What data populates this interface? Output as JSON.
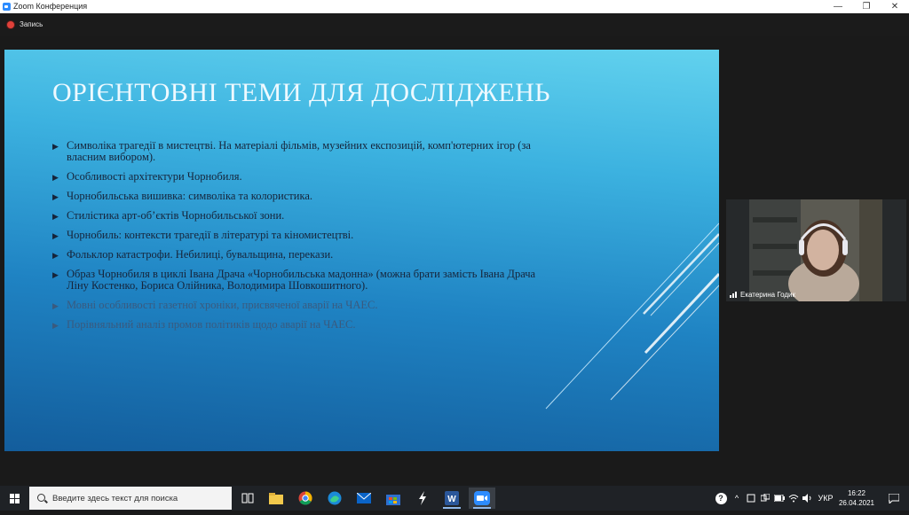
{
  "window": {
    "title": "Zoom Конференция",
    "controls": {
      "minimize": "—",
      "maximize": "❐",
      "close": "✕"
    }
  },
  "recording": {
    "label": "Запись",
    "color": "#e0413a"
  },
  "slide": {
    "title": "ОРІЄНТОВНІ ТЕМИ ДЛЯ ДОСЛІДЖЕНЬ",
    "bullet_glyph": "▶",
    "items": [
      {
        "text": "Символіка трагедії в мистецтві. На матеріалі фільмів, музейних експозицій, комп'ютерних ігор (за власним вибором).",
        "highlight": true
      },
      {
        "text": "Особливості архітектури Чорнобиля.",
        "highlight": true
      },
      {
        "text": "Чорнобильська вишивка: символіка та колористика.",
        "highlight": true
      },
      {
        "text": "Стилістика арт-об’єктів Чорнобильської зони.",
        "highlight": true
      },
      {
        "text": "Чорнобиль: контексти трагедії в літературі та кіномистецтві.",
        "highlight": true
      },
      {
        "text": "Фольклор катастрофи. Небилиці, бувальщина, перекази.",
        "highlight": true
      },
      {
        "text": "Образ Чорнобиля в циклі Івана Драча «Чорнобильська мадонна» (можна брати замість Івана Драча Ліну Костенко, Бориса Олійника, Володимира Шовкошитного).",
        "highlight": true
      },
      {
        "text": "Мовні особливості газетної хроніки, присвяченої аварії на ЧАЕС.",
        "highlight": false
      },
      {
        "text": "Порівняльний аналіз промов політиків щодо аварії на ЧАЕС.",
        "highlight": false
      }
    ],
    "colors": {
      "highlight_text": "#16243a",
      "dim_text": "#3a5a7e",
      "title": "#eef9ff"
    }
  },
  "participant": {
    "name": "Екатерина Годик"
  },
  "taskbar": {
    "search_placeholder": "Введите здесь текст для поиска",
    "apps": [
      "task-view",
      "file-explorer",
      "chrome",
      "edge",
      "mail",
      "store",
      "app-s",
      "word",
      "zoom"
    ],
    "tray": {
      "help": "?",
      "chevron": "^",
      "lang": "УКР"
    },
    "time": "16:22",
    "date": "26.04.2021"
  }
}
